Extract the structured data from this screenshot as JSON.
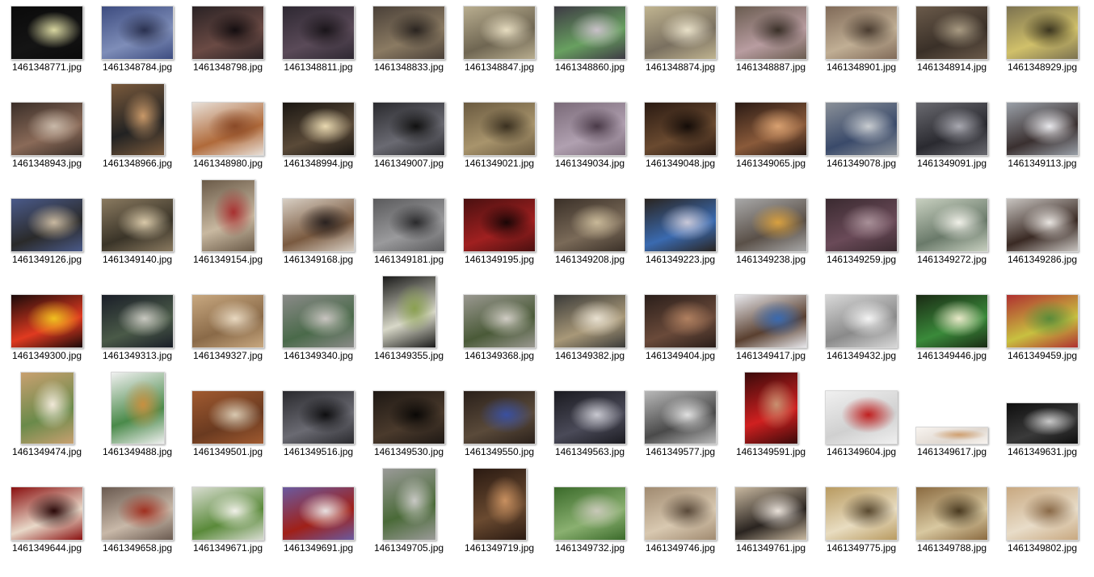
{
  "files": [
    {
      "name": "1461348771.jpg",
      "shape": "land",
      "colors": [
        "#0a0a0a",
        "#141414",
        "#d8d6a0"
      ]
    },
    {
      "name": "1461348784.jpg",
      "shape": "land",
      "colors": [
        "#3d4c80",
        "#7e8db8",
        "#2a3150"
      ]
    },
    {
      "name": "1461348798.jpg",
      "shape": "land",
      "colors": [
        "#2a2224",
        "#6a4a44",
        "#140e10"
      ]
    },
    {
      "name": "1461348811.jpg",
      "shape": "land",
      "colors": [
        "#2e2832",
        "#5a4a58",
        "#1a151a"
      ]
    },
    {
      "name": "1461348833.jpg",
      "shape": "land",
      "colors": [
        "#4a4038",
        "#8a7a62",
        "#2a2420"
      ]
    },
    {
      "name": "1461348847.jpg",
      "shape": "land",
      "colors": [
        "#b8ad8f",
        "#6f6652",
        "#e6dcc0"
      ]
    },
    {
      "name": "1461348860.jpg",
      "shape": "land",
      "colors": [
        "#3d3a44",
        "#68a060",
        "#c8c0c8"
      ]
    },
    {
      "name": "1461348874.jpg",
      "shape": "land",
      "colors": [
        "#c0b490",
        "#7a7060",
        "#e8e0c8"
      ]
    },
    {
      "name": "1461348887.jpg",
      "shape": "land",
      "colors": [
        "#6a5c50",
        "#b89ca0",
        "#3a3028"
      ]
    },
    {
      "name": "1461348901.jpg",
      "shape": "land",
      "colors": [
        "#806a58",
        "#c0ae94",
        "#4a3c30"
      ]
    },
    {
      "name": "1461348914.jpg",
      "shape": "land",
      "colors": [
        "#6a5a4a",
        "#3a3028",
        "#a89a82"
      ]
    },
    {
      "name": "1461348929.jpg",
      "shape": "land",
      "colors": [
        "#7c7250",
        "#d0c06a",
        "#3c3620"
      ]
    },
    {
      "name": "1461348943.jpg",
      "shape": "land",
      "colors": [
        "#3a2e28",
        "#8a6a58",
        "#c8b8a8"
      ]
    },
    {
      "name": "1461348966.jpg",
      "shape": "port",
      "colors": [
        "#7a5a3c",
        "#222",
        "#c89868"
      ]
    },
    {
      "name": "1461348980.jpg",
      "shape": "land",
      "colors": [
        "#e8e0d8",
        "#b06a3a",
        "#8a4a28"
      ]
    },
    {
      "name": "1461348994.jpg",
      "shape": "land",
      "colors": [
        "#1a1612",
        "#5a4a38",
        "#e8d8b0"
      ]
    },
    {
      "name": "1461349007.jpg",
      "shape": "land",
      "colors": [
        "#2a2a2e",
        "#6a6a72",
        "#111"
      ]
    },
    {
      "name": "1461349021.jpg",
      "shape": "land",
      "colors": [
        "#6a5a40",
        "#a8946c",
        "#3a3020"
      ]
    },
    {
      "name": "1461349034.jpg",
      "shape": "land",
      "colors": [
        "#7a6a78",
        "#b0a0b0",
        "#4a3a48"
      ]
    },
    {
      "name": "1461349048.jpg",
      "shape": "land",
      "colors": [
        "#2a1a12",
        "#6a4a30",
        "#140c08"
      ]
    },
    {
      "name": "1461349065.jpg",
      "shape": "land",
      "colors": [
        "#2a1a14",
        "#8a5a3a",
        "#d8a070"
      ]
    },
    {
      "name": "1461349078.jpg",
      "shape": "land",
      "colors": [
        "#8a9098",
        "#3a4a6a",
        "#c8ccd0"
      ]
    },
    {
      "name": "1461349091.jpg",
      "shape": "land",
      "colors": [
        "#6a6a70",
        "#2a2a30",
        "#a8a8b0"
      ]
    },
    {
      "name": "1461349113.jpg",
      "shape": "land",
      "colors": [
        "#9aa0a8",
        "#3a3030",
        "#e8e8ec"
      ]
    },
    {
      "name": "1461349126.jpg",
      "shape": "land",
      "colors": [
        "#4a5a8a",
        "#2a2a2a",
        "#c8b8a0"
      ]
    },
    {
      "name": "1461349140.jpg",
      "shape": "land",
      "colors": [
        "#8a7a60",
        "#3a3428",
        "#d8c8a8"
      ]
    },
    {
      "name": "1461349154.jpg",
      "shape": "port",
      "colors": [
        "#6a5a48",
        "#c8b8a0",
        "#a83030"
      ]
    },
    {
      "name": "1461349168.jpg",
      "shape": "land",
      "colors": [
        "#d8cfc4",
        "#7a5a40",
        "#2a2220"
      ]
    },
    {
      "name": "1461349181.jpg",
      "shape": "land",
      "colors": [
        "#5a5a5c",
        "#9a9a9c",
        "#2a2a2c"
      ]
    },
    {
      "name": "1461349195.jpg",
      "shape": "land",
      "colors": [
        "#4a1010",
        "#a02020",
        "#1a0606"
      ]
    },
    {
      "name": "1461349208.jpg",
      "shape": "land",
      "colors": [
        "#3a3028",
        "#7a6a58",
        "#c8b898"
      ]
    },
    {
      "name": "1461349223.jpg",
      "shape": "land",
      "colors": [
        "#2a2420",
        "#3a6ab0",
        "#c8c8d8"
      ]
    },
    {
      "name": "1461349238.jpg",
      "shape": "land",
      "colors": [
        "#a8a8a8",
        "#5a5048",
        "#d8a040"
      ]
    },
    {
      "name": "1461349259.jpg",
      "shape": "land",
      "colors": [
        "#3a2a30",
        "#6a4a58",
        "#a89098"
      ]
    },
    {
      "name": "1461349272.jpg",
      "shape": "land",
      "colors": [
        "#c8d0c0",
        "#6a7a6a",
        "#f0f0e8"
      ]
    },
    {
      "name": "1461349286.jpg",
      "shape": "land",
      "colors": [
        "#c8c4c0",
        "#3a2a24",
        "#e8e4e0"
      ]
    },
    {
      "name": "1461349300.jpg",
      "shape": "land",
      "colors": [
        "#1a0a0a",
        "#e03a20",
        "#f0c020"
      ]
    },
    {
      "name": "1461349313.jpg",
      "shape": "land",
      "colors": [
        "#1a1e28",
        "#4a5a48",
        "#c8c8c0"
      ]
    },
    {
      "name": "1461349327.jpg",
      "shape": "land",
      "colors": [
        "#c8a880",
        "#8a6a48",
        "#e8d8c0"
      ]
    },
    {
      "name": "1461349340.jpg",
      "shape": "land",
      "colors": [
        "#8a8a88",
        "#4a6a4a",
        "#c8c4c0"
      ]
    },
    {
      "name": "1461349355.jpg",
      "shape": "port",
      "colors": [
        "#1a1a1a",
        "#d8d8c8",
        "#8aa050"
      ]
    },
    {
      "name": "1461349368.jpg",
      "shape": "land",
      "colors": [
        "#9a9890",
        "#4a5a38",
        "#d0ccc4"
      ]
    },
    {
      "name": "1461349382.jpg",
      "shape": "land",
      "colors": [
        "#3a3a38",
        "#a89878",
        "#e8e0d0"
      ]
    },
    {
      "name": "1461349404.jpg",
      "shape": "land",
      "colors": [
        "#2a1e1a",
        "#6a4a3a",
        "#b08060"
      ]
    },
    {
      "name": "1461349417.jpg",
      "shape": "land",
      "colors": [
        "#e8e8ec",
        "#5a4030",
        "#3a6ab0"
      ]
    },
    {
      "name": "1461349432.jpg",
      "shape": "land",
      "colors": [
        "#d8d8d8",
        "#8a8a8a",
        "#f4f4f4"
      ]
    },
    {
      "name": "1461349446.jpg",
      "shape": "land",
      "colors": [
        "#1a2a14",
        "#3a8a3a",
        "#e8e8c8"
      ]
    },
    {
      "name": "1461349459.jpg",
      "shape": "land",
      "colors": [
        "#b03030",
        "#c8c040",
        "#5a8a3a"
      ]
    },
    {
      "name": "1461349474.jpg",
      "shape": "port",
      "colors": [
        "#c8a070",
        "#6a8a4a",
        "#f0e8d8"
      ]
    },
    {
      "name": "1461349488.jpg",
      "shape": "port",
      "colors": [
        "#f0f0f0",
        "#4a8a4a",
        "#c89040"
      ]
    },
    {
      "name": "1461349501.jpg",
      "shape": "land",
      "colors": [
        "#a05a30",
        "#6a3a20",
        "#d8c8b0"
      ]
    },
    {
      "name": "1461349516.jpg",
      "shape": "land",
      "colors": [
        "#2a2a2e",
        "#6a6a72",
        "#0e0e10"
      ]
    },
    {
      "name": "1461349530.jpg",
      "shape": "land",
      "colors": [
        "#1e1814",
        "#4a3a2c",
        "#0a0806"
      ]
    },
    {
      "name": "1461349550.jpg",
      "shape": "land",
      "colors": [
        "#2a201a",
        "#5a4a3a",
        "#3a50a0"
      ]
    },
    {
      "name": "1461349563.jpg",
      "shape": "land",
      "colors": [
        "#1a1a20",
        "#4a4a58",
        "#c8c8d0"
      ]
    },
    {
      "name": "1461349577.jpg",
      "shape": "land",
      "colors": [
        "#b8b8b8",
        "#4a4a4a",
        "#e0e0e0"
      ]
    },
    {
      "name": "1461349591.jpg",
      "shape": "port",
      "colors": [
        "#3a0a0a",
        "#d02020",
        "#c89070"
      ]
    },
    {
      "name": "1461349604.jpg",
      "shape": "land",
      "colors": [
        "#f0f0f0",
        "#d0d0d0",
        "#c02020"
      ]
    },
    {
      "name": "1461349617.jpg",
      "shape": "wide",
      "colors": [
        "#f8f4f0",
        "#e0d8d0",
        "#d0a070"
      ]
    },
    {
      "name": "1461349631.jpg",
      "shape": "wide2",
      "colors": [
        "#0e0e0e",
        "#3a3a3a",
        "#c8c8c8"
      ]
    },
    {
      "name": "1461349644.jpg",
      "shape": "land",
      "colors": [
        "#8a1010",
        "#e8d8c8",
        "#2a0808"
      ]
    },
    {
      "name": "1461349658.jpg",
      "shape": "land",
      "colors": [
        "#6a5a50",
        "#c8b8a8",
        "#a03020"
      ]
    },
    {
      "name": "1461349671.jpg",
      "shape": "land",
      "colors": [
        "#d8dcd0",
        "#5a8a3a",
        "#f0f0e8"
      ]
    },
    {
      "name": "1461349691.jpg",
      "shape": "land",
      "colors": [
        "#6a5aa0",
        "#a02018",
        "#e8e0e0"
      ]
    },
    {
      "name": "1461349705.jpg",
      "shape": "port",
      "colors": [
        "#9a9a98",
        "#4a6a38",
        "#c8c8c4"
      ]
    },
    {
      "name": "1461349719.jpg",
      "shape": "port",
      "colors": [
        "#2a1a12",
        "#6a4a30",
        "#c89060"
      ]
    },
    {
      "name": "1461349732.jpg",
      "shape": "land",
      "colors": [
        "#3a6a2a",
        "#8ab070",
        "#c8c8b8"
      ]
    },
    {
      "name": "1461349746.jpg",
      "shape": "land",
      "colors": [
        "#a08a70",
        "#d8c8b0",
        "#5a4a3a"
      ]
    },
    {
      "name": "1461349761.jpg",
      "shape": "land",
      "colors": [
        "#c8b8a0",
        "#2a2420",
        "#e8e0d8"
      ]
    },
    {
      "name": "1461349775.jpg",
      "shape": "land",
      "colors": [
        "#b89a60",
        "#e8dcc0",
        "#5a4a30"
      ]
    },
    {
      "name": "1461349788.jpg",
      "shape": "land",
      "colors": [
        "#8a6a40",
        "#d8c8a0",
        "#4a3a20"
      ]
    },
    {
      "name": "1461349802.jpg",
      "shape": "land",
      "colors": [
        "#c8a880",
        "#e8dcc8",
        "#8a6a48"
      ]
    }
  ]
}
